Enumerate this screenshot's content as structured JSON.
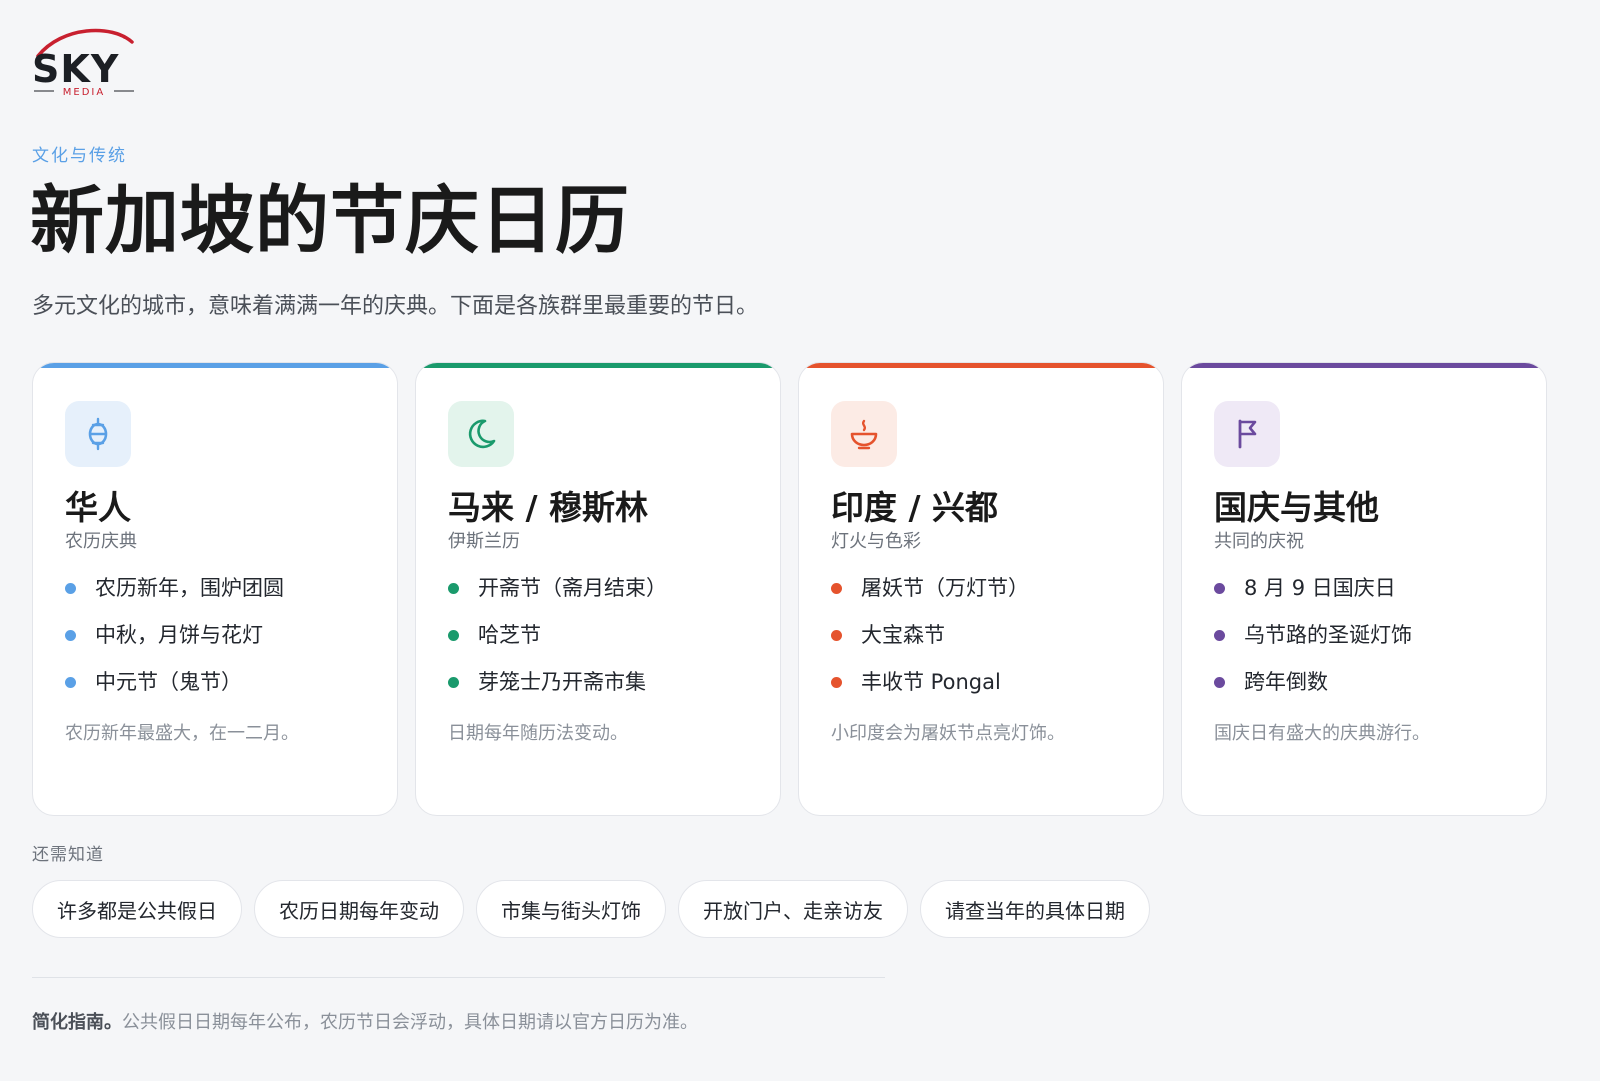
{
  "logo": {
    "wordmark": "SKY",
    "tagline": "MEDIA"
  },
  "kicker": "文化与传统",
  "title": "新加坡的节庆日历",
  "subtitle": "多元文化的城市，意味着满满一年的庆典。下面是各族群里最重要的节日。",
  "cards": [
    {
      "title": "华人",
      "subtitle": "农历庆典",
      "icon": "lantern-icon",
      "accent": "#5aa0e6",
      "soft": "#e6f0fb",
      "items": [
        "农历新年，围炉团圆",
        "中秋，月饼与花灯",
        "中元节（鬼节）"
      ],
      "note": "农历新年最盛大，在一二月。"
    },
    {
      "title": "马来 / 穆斯林",
      "subtitle": "伊斯兰历",
      "icon": "crescent-moon-icon",
      "accent": "#1a9a6c",
      "soft": "#e3f4ec",
      "items": [
        "开斋节（斋月结束）",
        "哈芝节",
        "芽笼士乃开斋市集"
      ],
      "note": "日期每年随历法变动。"
    },
    {
      "title": "印度 / 兴都",
      "subtitle": "灯火与色彩",
      "icon": "oil-lamp-icon",
      "accent": "#e5532d",
      "soft": "#fcebe5",
      "items": [
        "屠妖节（万灯节）",
        "大宝森节",
        "丰收节 Pongal"
      ],
      "note": "小印度会为屠妖节点亮灯饰。"
    },
    {
      "title": "国庆与其他",
      "subtitle": "共同的庆祝",
      "icon": "flag-icon",
      "accent": "#6b4a9e",
      "soft": "#efe9f6",
      "items": [
        "8 月 9 日国庆日",
        "乌节路的圣诞灯饰",
        "跨年倒数"
      ],
      "note": "国庆日有盛大的庆典游行。"
    }
  ],
  "know": {
    "label": "还需知道",
    "chips": [
      "许多都是公共假日",
      "农历日期每年变动",
      "市集与街头灯饰",
      "开放门户、走亲访友",
      "请查当年的具体日期"
    ]
  },
  "footnote": {
    "lead": "简化指南。",
    "text": "公共假日日期每年公布，农历节日会浮动，具体日期请以官方日历为准。"
  }
}
